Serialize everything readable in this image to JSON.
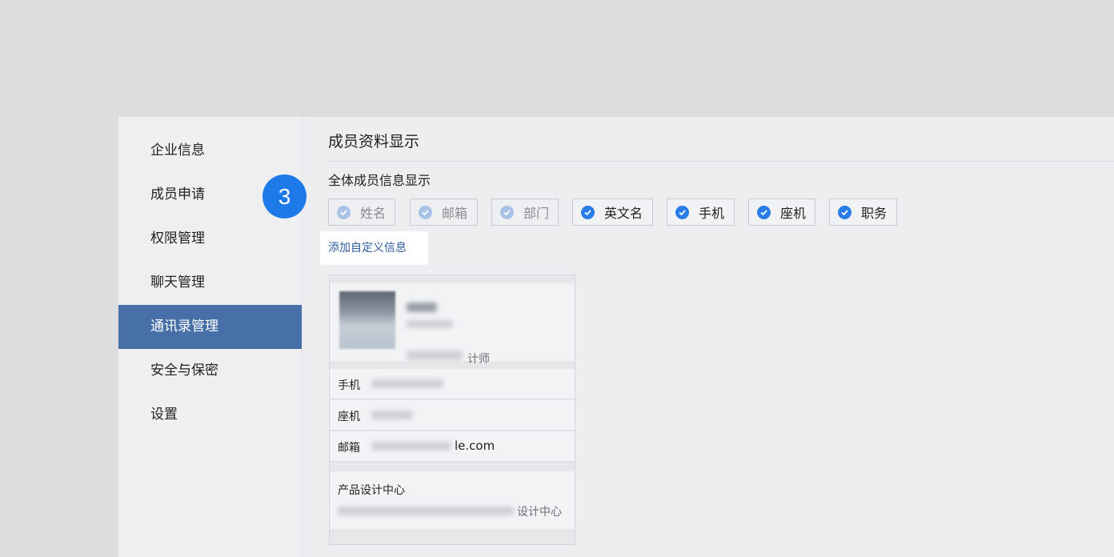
{
  "sidebar": {
    "items": [
      {
        "label": "企业信息",
        "active": false
      },
      {
        "label": "成员申请",
        "active": false
      },
      {
        "label": "权限管理",
        "active": false
      },
      {
        "label": "聊天管理",
        "active": false
      },
      {
        "label": "通讯录管理",
        "active": true
      },
      {
        "label": "安全与保密",
        "active": false
      },
      {
        "label": "设置",
        "active": false
      }
    ]
  },
  "step_badge": "3",
  "main": {
    "title": "成员资料显示",
    "section_title": "全体成员信息显示",
    "fields": [
      {
        "label": "姓名",
        "checked": true,
        "disabled": true
      },
      {
        "label": "邮箱",
        "checked": true,
        "disabled": true
      },
      {
        "label": "部门",
        "checked": true,
        "disabled": true
      },
      {
        "label": "英文名",
        "checked": true,
        "disabled": false
      },
      {
        "label": "手机",
        "checked": true,
        "disabled": false
      },
      {
        "label": "座机",
        "checked": true,
        "disabled": false
      },
      {
        "label": "职务",
        "checked": true,
        "disabled": false
      }
    ],
    "add_custom_link": "添加自定义信息"
  },
  "preview_card": {
    "position_tail": "计师",
    "rows": [
      {
        "label": "手机",
        "tail": ""
      },
      {
        "label": "座机",
        "tail": ""
      },
      {
        "label": "邮箱",
        "tail": "le.com"
      }
    ],
    "department_title": "产品设计中心",
    "department_path_tail": "设计中心"
  },
  "colors": {
    "accent": "#1e7ae8",
    "sidebar_active": "#4870a8",
    "check": "#2a7de9",
    "link": "#2f5c9c"
  }
}
